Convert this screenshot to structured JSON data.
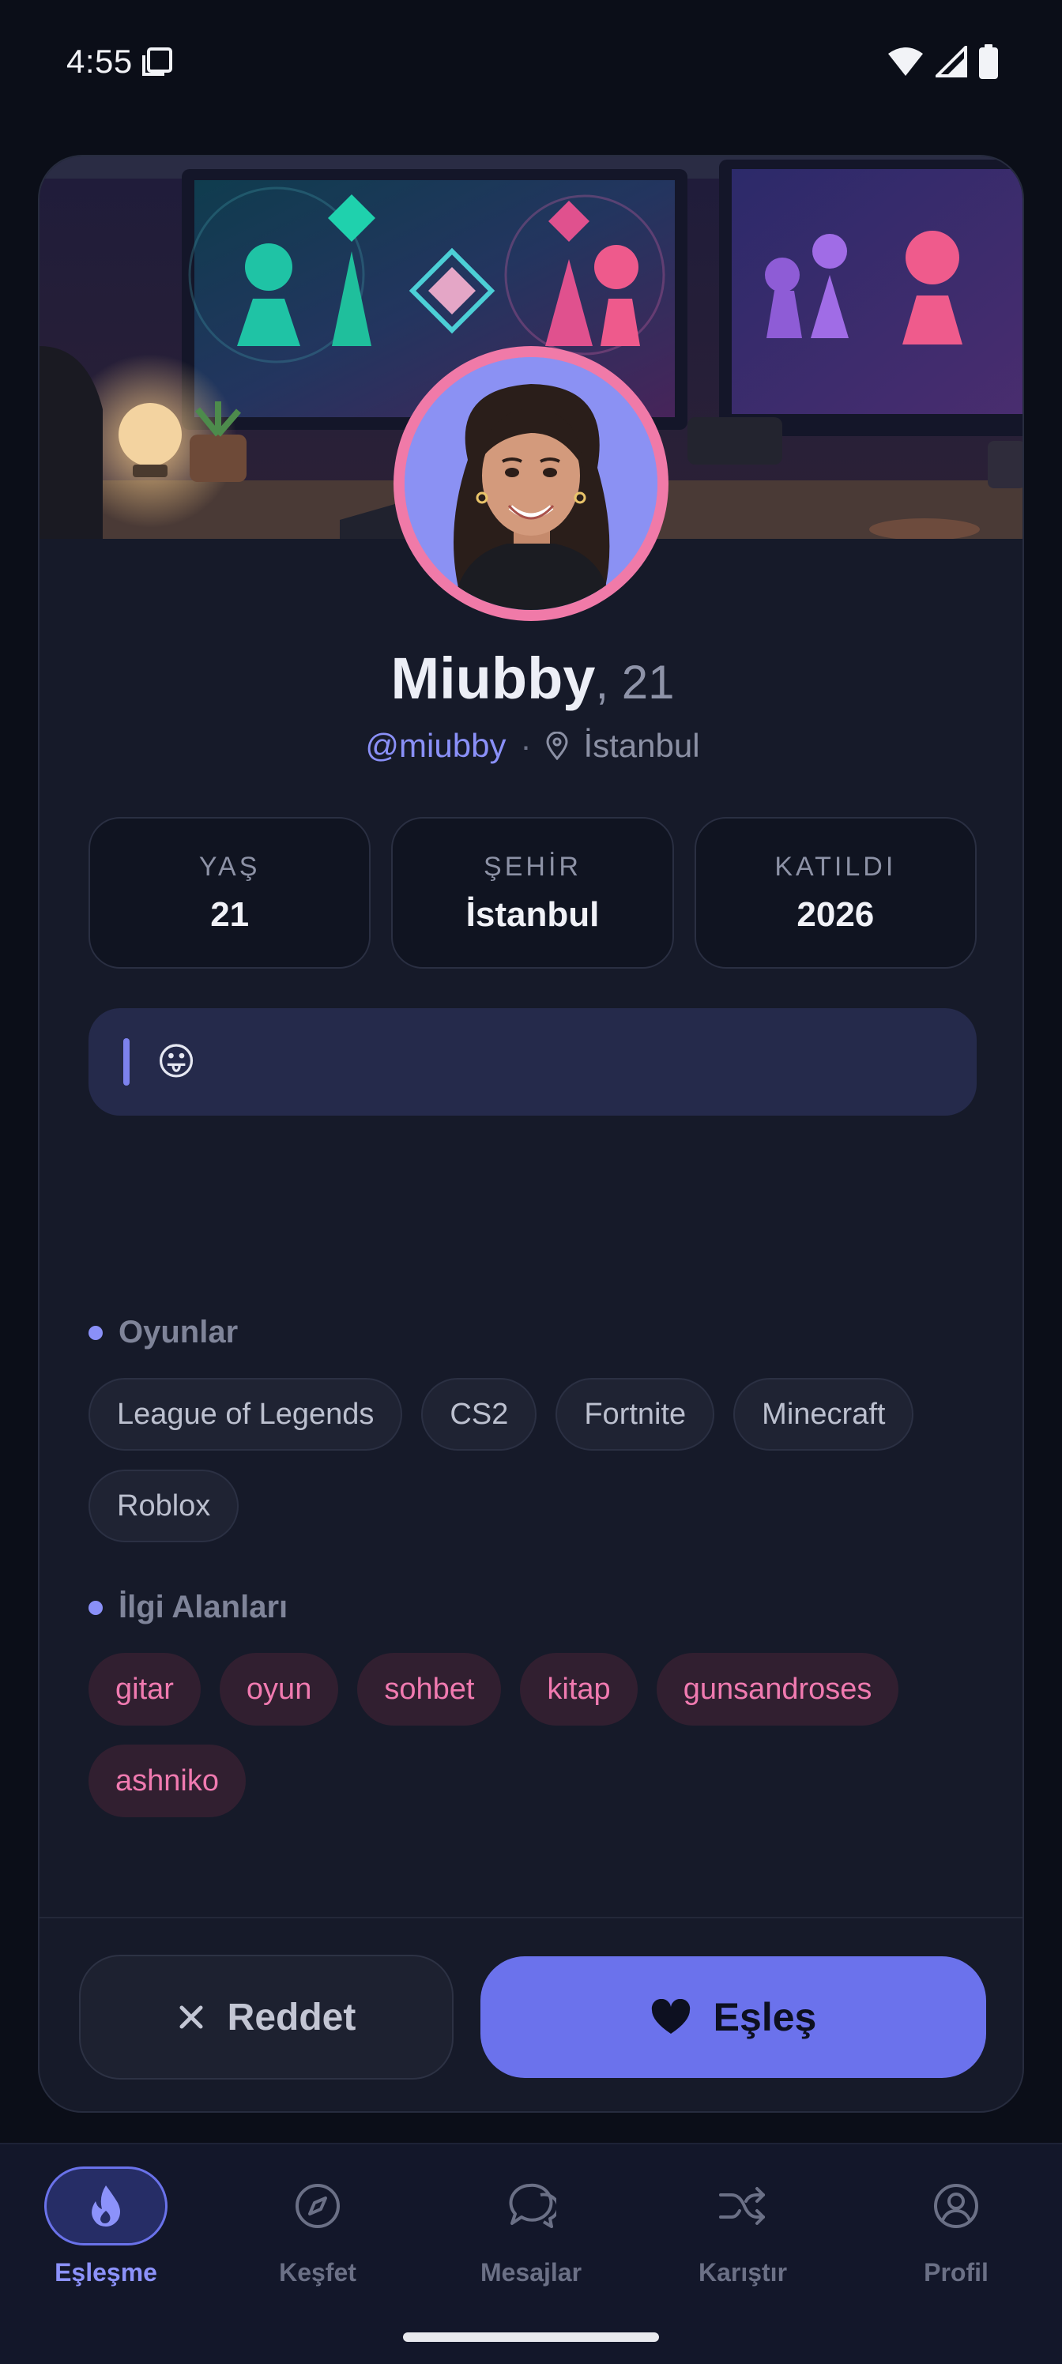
{
  "status_bar": {
    "time": "4:55"
  },
  "profile": {
    "name": "Miubby",
    "age_suffix": ", 21",
    "handle": "@miubby",
    "separator": "·",
    "city": "İstanbul"
  },
  "stats": [
    {
      "label": "YAŞ",
      "value": "21"
    },
    {
      "label": "ŞEHİR",
      "value": "İstanbul"
    },
    {
      "label": "KATILDI",
      "value": "2026"
    }
  ],
  "bio": {
    "text": "😛"
  },
  "games": {
    "title": "Oyunlar",
    "items": [
      "League of Legends",
      "CS2",
      "Fortnite",
      "Minecraft",
      "Roblox"
    ]
  },
  "interests": {
    "title": "İlgi Alanları",
    "items": [
      "gitar",
      "oyun",
      "sohbet",
      "kitap",
      "gunsandroses",
      "ashniko"
    ]
  },
  "actions": {
    "reject_label": "Reddet",
    "match_label": "Eşleş"
  },
  "nav": {
    "items": [
      {
        "label": "Eşleşme",
        "icon": "flame-icon",
        "active": true
      },
      {
        "label": "Keşfet",
        "icon": "compass-icon",
        "active": false
      },
      {
        "label": "Mesajlar",
        "icon": "chat-icon",
        "active": false
      },
      {
        "label": "Karıştır",
        "icon": "shuffle-icon",
        "active": false
      },
      {
        "label": "Profil",
        "icon": "user-icon",
        "active": false
      }
    ]
  },
  "colors": {
    "accent": "#6b72ec",
    "interest_pink": "#f07ab0",
    "background": "#0b0e18",
    "card": "#161a29"
  }
}
